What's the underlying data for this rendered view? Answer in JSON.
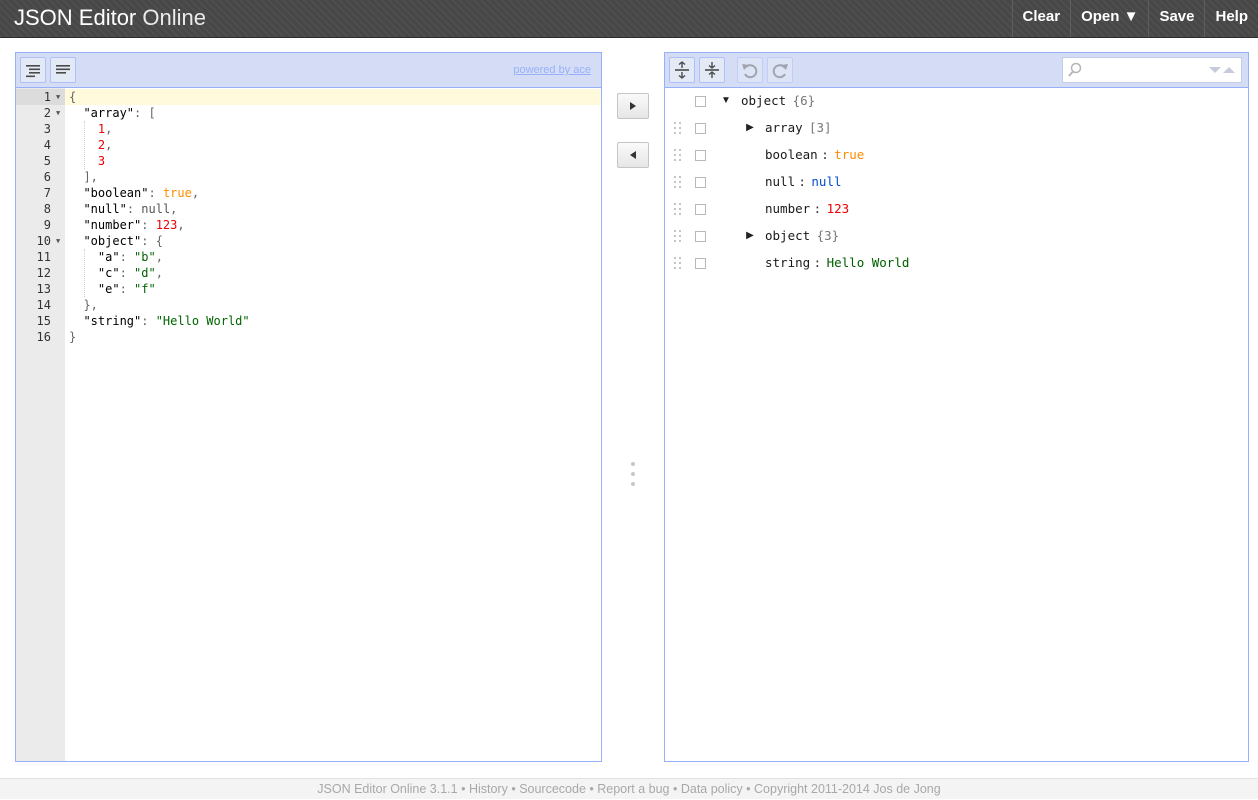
{
  "header": {
    "logo_main": "JSON Editor",
    "logo_sub": "Online",
    "menu": [
      {
        "label": "Clear"
      },
      {
        "label": "Open ▼"
      },
      {
        "label": "Save"
      },
      {
        "label": "Help"
      }
    ]
  },
  "code_editor": {
    "powered_by": "powered by ace",
    "active_line": 1,
    "lines": [
      {
        "num": "1",
        "fold": true
      },
      {
        "num": "2",
        "fold": true
      },
      {
        "num": "3",
        "fold": false
      },
      {
        "num": "4",
        "fold": false
      },
      {
        "num": "5",
        "fold": false
      },
      {
        "num": "6",
        "fold": false
      },
      {
        "num": "7",
        "fold": false
      },
      {
        "num": "8",
        "fold": false
      },
      {
        "num": "9",
        "fold": false
      },
      {
        "num": "10",
        "fold": true
      },
      {
        "num": "11",
        "fold": false
      },
      {
        "num": "12",
        "fold": false
      },
      {
        "num": "13",
        "fold": false
      },
      {
        "num": "14",
        "fold": false
      },
      {
        "num": "15",
        "fold": false
      },
      {
        "num": "16",
        "fold": false
      }
    ],
    "code": [
      [
        [
          "punc",
          "{"
        ]
      ],
      [
        [
          "punc",
          "  "
        ],
        [
          "key",
          "\"array\""
        ],
        [
          "punc",
          ": ["
        ]
      ],
      [
        [
          "punc",
          "    "
        ],
        [
          "num",
          "1"
        ],
        [
          "punc",
          ","
        ]
      ],
      [
        [
          "punc",
          "    "
        ],
        [
          "num",
          "2"
        ],
        [
          "punc",
          ","
        ]
      ],
      [
        [
          "punc",
          "    "
        ],
        [
          "num",
          "3"
        ]
      ],
      [
        [
          "punc",
          "  ],"
        ]
      ],
      [
        [
          "punc",
          "  "
        ],
        [
          "key",
          "\"boolean\""
        ],
        [
          "punc",
          ": "
        ],
        [
          "bool",
          "true"
        ],
        [
          "punc",
          ","
        ]
      ],
      [
        [
          "punc",
          "  "
        ],
        [
          "key",
          "\"null\""
        ],
        [
          "punc",
          ": "
        ],
        [
          "null",
          "null"
        ],
        [
          "punc",
          ","
        ]
      ],
      [
        [
          "punc",
          "  "
        ],
        [
          "key",
          "\"number\""
        ],
        [
          "punc",
          ": "
        ],
        [
          "num",
          "123"
        ],
        [
          "punc",
          ","
        ]
      ],
      [
        [
          "punc",
          "  "
        ],
        [
          "key",
          "\"object\""
        ],
        [
          "punc",
          ": {"
        ]
      ],
      [
        [
          "punc",
          "    "
        ],
        [
          "key",
          "\"a\""
        ],
        [
          "punc",
          ": "
        ],
        [
          "str",
          "\"b\""
        ],
        [
          "punc",
          ","
        ]
      ],
      [
        [
          "punc",
          "    "
        ],
        [
          "key",
          "\"c\""
        ],
        [
          "punc",
          ": "
        ],
        [
          "str",
          "\"d\""
        ],
        [
          "punc",
          ","
        ]
      ],
      [
        [
          "punc",
          "    "
        ],
        [
          "key",
          "\"e\""
        ],
        [
          "punc",
          ": "
        ],
        [
          "str",
          "\"f\""
        ]
      ],
      [
        [
          "punc",
          "  },"
        ]
      ],
      [
        [
          "punc",
          "  "
        ],
        [
          "key",
          "\"string\""
        ],
        [
          "punc",
          ": "
        ],
        [
          "str",
          "\"Hello World\""
        ]
      ],
      [
        [
          "punc",
          "}"
        ]
      ]
    ]
  },
  "tree_editor": {
    "search_placeholder": "",
    "rows": [
      {
        "field": "object",
        "meta": "{6}",
        "value": "",
        "value_type": "",
        "expandable": true,
        "expanded": true,
        "level": 0,
        "drag": false
      },
      {
        "field": "array",
        "meta": "[3]",
        "value": "",
        "value_type": "",
        "expandable": true,
        "expanded": false,
        "level": 1,
        "drag": true
      },
      {
        "field": "boolean",
        "meta": "",
        "value": "true",
        "value_type": "bool",
        "expandable": false,
        "expanded": false,
        "level": 1,
        "drag": true
      },
      {
        "field": "null",
        "meta": "",
        "value": "null",
        "value_type": "null",
        "expandable": false,
        "expanded": false,
        "level": 1,
        "drag": true
      },
      {
        "field": "number",
        "meta": "",
        "value": "123",
        "value_type": "num",
        "expandable": false,
        "expanded": false,
        "level": 1,
        "drag": true
      },
      {
        "field": "object",
        "meta": "{3}",
        "value": "",
        "value_type": "",
        "expandable": true,
        "expanded": false,
        "level": 1,
        "drag": true
      },
      {
        "field": "string",
        "meta": "",
        "value": "Hello World",
        "value_type": "str",
        "expandable": false,
        "expanded": false,
        "level": 1,
        "drag": true
      }
    ],
    "separator": ":"
  },
  "footer": {
    "items": [
      "JSON Editor Online 3.1.1",
      "History",
      "Sourcecode",
      "Report a bug",
      "Data policy",
      "Copyright 2011-2014 Jos de Jong"
    ],
    "separator": " • "
  }
}
